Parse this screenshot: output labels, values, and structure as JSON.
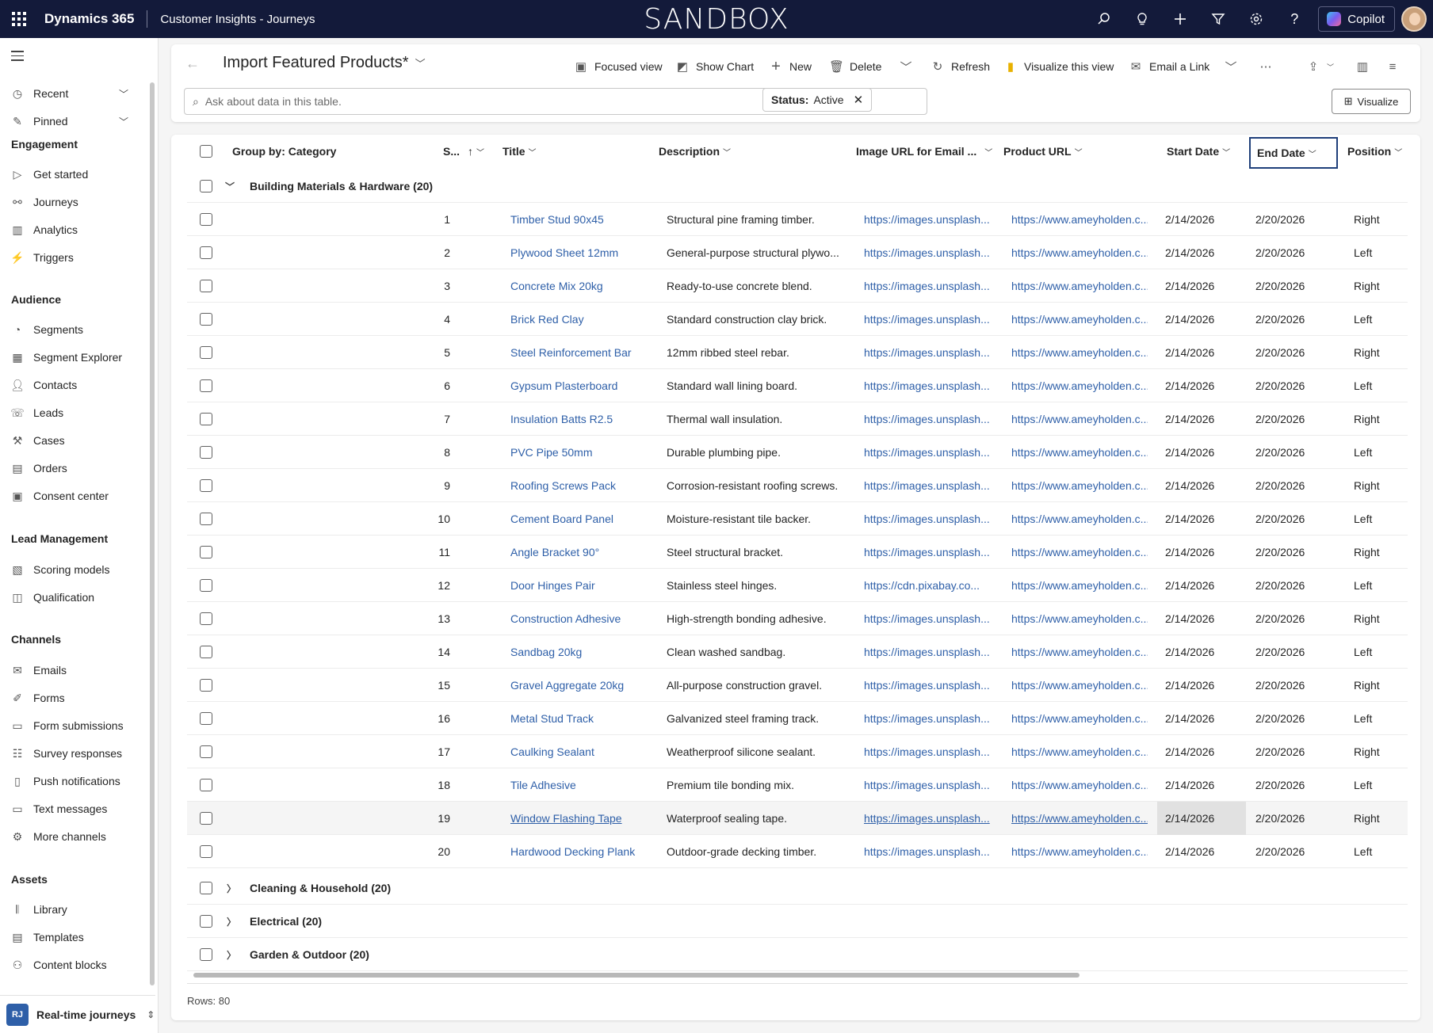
{
  "topbar": {
    "brand": "Dynamics 365",
    "area": "Customer Insights - Journeys",
    "environment": "SANDBOX",
    "copilot_label": "Copilot",
    "icons": [
      "search-icon",
      "lightbulb-icon",
      "plus-icon",
      "filter-icon",
      "gear-icon",
      "help-icon"
    ]
  },
  "sidebar": {
    "top_items": [
      {
        "label": "Recent",
        "icon": "clock-icon"
      },
      {
        "label": "Pinned",
        "icon": "pin-icon"
      }
    ],
    "sections": [
      {
        "heading": "Engagement",
        "items": [
          {
            "label": "Get started",
            "icon": "play-icon"
          },
          {
            "label": "Journeys",
            "icon": "journey-icon"
          },
          {
            "label": "Analytics",
            "icon": "analytics-icon"
          },
          {
            "label": "Triggers",
            "icon": "trigger-icon"
          }
        ]
      },
      {
        "heading": "Audience",
        "items": [
          {
            "label": "Segments",
            "icon": "segments-icon"
          },
          {
            "label": "Segment Explorer",
            "icon": "segment-explorer-icon"
          },
          {
            "label": "Contacts",
            "icon": "person-icon"
          },
          {
            "label": "Leads",
            "icon": "leads-icon"
          },
          {
            "label": "Cases",
            "icon": "wrench-icon"
          },
          {
            "label": "Orders",
            "icon": "document-icon"
          },
          {
            "label": "Consent center",
            "icon": "consent-icon"
          }
        ]
      },
      {
        "heading": "Lead Management",
        "items": [
          {
            "label": "Scoring models",
            "icon": "scoring-icon"
          },
          {
            "label": "Qualification",
            "icon": "qualification-icon"
          }
        ]
      },
      {
        "heading": "Channels",
        "items": [
          {
            "label": "Emails",
            "icon": "mail-icon"
          },
          {
            "label": "Forms",
            "icon": "form-icon"
          },
          {
            "label": "Form submissions",
            "icon": "form-submission-icon"
          },
          {
            "label": "Survey responses",
            "icon": "survey-icon"
          },
          {
            "label": "Push notifications",
            "icon": "phone-icon"
          },
          {
            "label": "Text messages",
            "icon": "chat-icon"
          },
          {
            "label": "More channels",
            "icon": "more-channels-icon"
          }
        ]
      },
      {
        "heading": "Assets",
        "items": [
          {
            "label": "Library",
            "icon": "library-icon"
          },
          {
            "label": "Templates",
            "icon": "templates-icon"
          },
          {
            "label": "Content blocks",
            "icon": "content-blocks-icon"
          }
        ]
      }
    ],
    "footer": {
      "badge": "RJ",
      "label": "Real-time journeys"
    }
  },
  "commandbar": {
    "view_title": "Import Featured Products*",
    "buttons": {
      "focused_view": "Focused view",
      "show_chart": "Show Chart",
      "new": "New",
      "delete": "Delete",
      "refresh": "Refresh",
      "visualize_view": "Visualize this view",
      "email_link": "Email a Link"
    },
    "ask_placeholder": "Ask about data in this table.",
    "filter": {
      "label": "Status:",
      "value": "Active"
    },
    "visualize_label": "Visualize"
  },
  "grid": {
    "headers": {
      "group_by": "Group by: Category",
      "seq": "S...",
      "title": "Title",
      "description": "Description",
      "image_url": "Image URL for Email ...",
      "product_url": "Product URL",
      "start_date": "Start Date",
      "end_date": "End Date",
      "position": "Position"
    },
    "expanded_group": "Building Materials & Hardware (20)",
    "rows": [
      {
        "n": "1",
        "title": "Timber Stud 90x45",
        "desc": "Structural pine framing timber.",
        "img": "https://images.unsplash...",
        "url": "https://www.ameyholden.c...",
        "start": "2/14/2026",
        "end": "2/20/2026",
        "pos": "Right"
      },
      {
        "n": "2",
        "title": "Plywood Sheet 12mm",
        "desc": "General-purpose structural plywo...",
        "img": "https://images.unsplash...",
        "url": "https://www.ameyholden.c...",
        "start": "2/14/2026",
        "end": "2/20/2026",
        "pos": "Left"
      },
      {
        "n": "3",
        "title": "Concrete Mix 20kg",
        "desc": "Ready-to-use concrete blend.",
        "img": "https://images.unsplash...",
        "url": "https://www.ameyholden.c...",
        "start": "2/14/2026",
        "end": "2/20/2026",
        "pos": "Right"
      },
      {
        "n": "4",
        "title": "Brick Red Clay",
        "desc": "Standard construction clay brick.",
        "img": "https://images.unsplash...",
        "url": "https://www.ameyholden.c...",
        "start": "2/14/2026",
        "end": "2/20/2026",
        "pos": "Left"
      },
      {
        "n": "5",
        "title": "Steel Reinforcement Bar",
        "desc": "12mm ribbed steel rebar.",
        "img": "https://images.unsplash...",
        "url": "https://www.ameyholden.c...",
        "start": "2/14/2026",
        "end": "2/20/2026",
        "pos": "Right"
      },
      {
        "n": "6",
        "title": "Gypsum Plasterboard",
        "desc": "Standard wall lining board.",
        "img": "https://images.unsplash...",
        "url": "https://www.ameyholden.c...",
        "start": "2/14/2026",
        "end": "2/20/2026",
        "pos": "Left"
      },
      {
        "n": "7",
        "title": "Insulation Batts R2.5",
        "desc": "Thermal wall insulation.",
        "img": "https://images.unsplash...",
        "url": "https://www.ameyholden.c...",
        "start": "2/14/2026",
        "end": "2/20/2026",
        "pos": "Right"
      },
      {
        "n": "8",
        "title": "PVC Pipe 50mm",
        "desc": "Durable plumbing pipe.",
        "img": "https://images.unsplash...",
        "url": "https://www.ameyholden.c...",
        "start": "2/14/2026",
        "end": "2/20/2026",
        "pos": "Left"
      },
      {
        "n": "9",
        "title": "Roofing Screws Pack",
        "desc": "Corrosion-resistant roofing screws.",
        "img": "https://images.unsplash...",
        "url": "https://www.ameyholden.c...",
        "start": "2/14/2026",
        "end": "2/20/2026",
        "pos": "Right"
      },
      {
        "n": "10",
        "title": "Cement Board Panel",
        "desc": "Moisture-resistant tile backer.",
        "img": "https://images.unsplash...",
        "url": "https://www.ameyholden.c...",
        "start": "2/14/2026",
        "end": "2/20/2026",
        "pos": "Left"
      },
      {
        "n": "11",
        "title": "Angle Bracket 90°",
        "desc": "Steel structural bracket.",
        "img": "https://images.unsplash...",
        "url": "https://www.ameyholden.c...",
        "start": "2/14/2026",
        "end": "2/20/2026",
        "pos": "Right"
      },
      {
        "n": "12",
        "title": "Door Hinges Pair",
        "desc": "Stainless steel hinges.",
        "img": "https://cdn.pixabay.co...",
        "url": "https://www.ameyholden.c...",
        "start": "2/14/2026",
        "end": "2/20/2026",
        "pos": "Left"
      },
      {
        "n": "13",
        "title": "Construction Adhesive",
        "desc": "High-strength bonding adhesive.",
        "img": "https://images.unsplash...",
        "url": "https://www.ameyholden.c...",
        "start": "2/14/2026",
        "end": "2/20/2026",
        "pos": "Right"
      },
      {
        "n": "14",
        "title": "Sandbag 20kg",
        "desc": "Clean washed sandbag.",
        "img": "https://images.unsplash...",
        "url": "https://www.ameyholden.c...",
        "start": "2/14/2026",
        "end": "2/20/2026",
        "pos": "Left"
      },
      {
        "n": "15",
        "title": "Gravel Aggregate 20kg",
        "desc": "All-purpose construction gravel.",
        "img": "https://images.unsplash...",
        "url": "https://www.ameyholden.c...",
        "start": "2/14/2026",
        "end": "2/20/2026",
        "pos": "Right"
      },
      {
        "n": "16",
        "title": "Metal Stud Track",
        "desc": "Galvanized steel framing track.",
        "img": "https://images.unsplash...",
        "url": "https://www.ameyholden.c...",
        "start": "2/14/2026",
        "end": "2/20/2026",
        "pos": "Left"
      },
      {
        "n": "17",
        "title": "Caulking Sealant",
        "desc": "Weatherproof silicone sealant.",
        "img": "https://images.unsplash...",
        "url": "https://www.ameyholden.c...",
        "start": "2/14/2026",
        "end": "2/20/2026",
        "pos": "Right"
      },
      {
        "n": "18",
        "title": "Tile Adhesive",
        "desc": "Premium tile bonding mix.",
        "img": "https://images.unsplash...",
        "url": "https://www.ameyholden.c...",
        "start": "2/14/2026",
        "end": "2/20/2026",
        "pos": "Left"
      },
      {
        "n": "19",
        "title": "Window Flashing Tape",
        "desc": "Waterproof sealing tape.",
        "img": "https://images.unsplash...",
        "url": "https://www.ameyholden.c...",
        "start": "2/14/2026",
        "end": "2/20/2026",
        "pos": "Right"
      },
      {
        "n": "20",
        "title": "Hardwood Decking Plank",
        "desc": "Outdoor-grade decking timber.",
        "img": "https://images.unsplash...",
        "url": "https://www.ameyholden.c...",
        "start": "2/14/2026",
        "end": "2/20/2026",
        "pos": "Left"
      }
    ],
    "collapsed_groups": [
      "Cleaning & Household (20)",
      "Electrical (20)",
      "Garden & Outdoor (20)"
    ],
    "rows_count": "Rows: 80"
  },
  "colors": {
    "topbar": "#131a3a",
    "link": "#2e5fa8",
    "accent_border": "#1f3f7a"
  }
}
